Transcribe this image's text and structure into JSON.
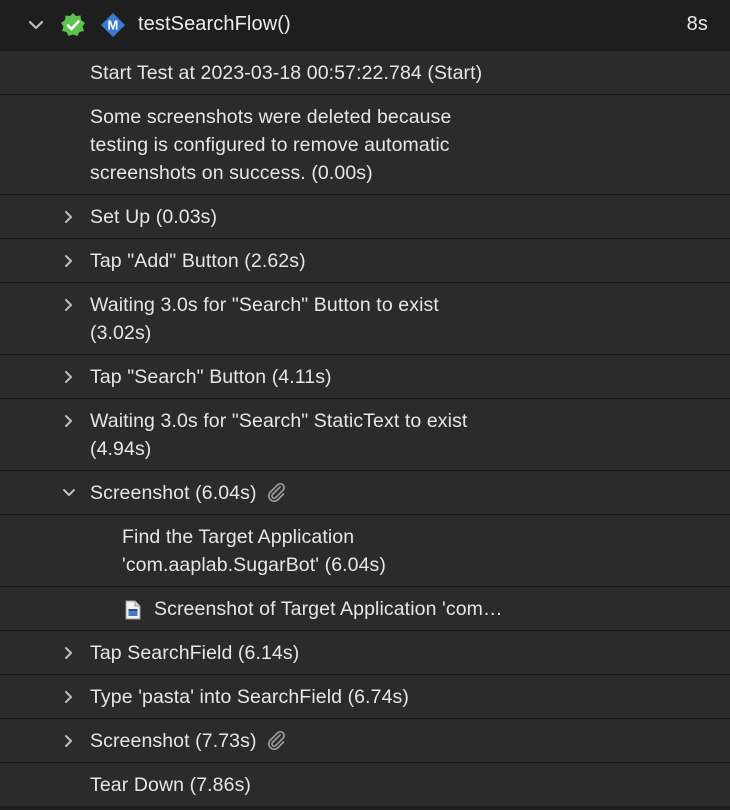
{
  "header": {
    "title": "testSearchFlow()",
    "duration": "8s",
    "badge_letter": "M",
    "pass_color": "#5ec04f",
    "badge_color": "#3a7bd5",
    "expand_icon": "chevron-down-icon",
    "status_icon": "checkmark-passed-icon"
  },
  "rows": [
    {
      "lines": [
        "Start Test at 2023-03-18 00:57:22.784 (Start)"
      ],
      "disclosure": "none"
    },
    {
      "lines": [
        "Some screenshots were deleted because",
        "testing is configured to remove automatic",
        "screenshots on success. (0.00s)"
      ],
      "disclosure": "none"
    },
    {
      "lines": [
        "Set Up (0.03s)"
      ],
      "disclosure": "collapsed"
    },
    {
      "lines": [
        "Tap \"Add\" Button (2.62s)"
      ],
      "disclosure": "collapsed"
    },
    {
      "lines": [
        "Waiting 3.0s for \"Search\" Button to exist",
        "(3.02s)"
      ],
      "disclosure": "collapsed"
    },
    {
      "lines": [
        "Tap \"Search\" Button (4.11s)"
      ],
      "disclosure": "collapsed"
    },
    {
      "lines": [
        "Waiting 3.0s for \"Search\" StaticText to exist",
        "(4.94s)"
      ],
      "disclosure": "collapsed"
    },
    {
      "lines": [
        "Screenshot (6.04s)"
      ],
      "disclosure": "expanded",
      "attachment": true
    },
    {
      "lines": [
        "Find the Target Application",
        "'com.aaplab.SugarBot' (6.04s)"
      ],
      "disclosure": "none",
      "indent": 1
    },
    {
      "lines": [
        "Screenshot of Target Application 'com…"
      ],
      "disclosure": "none",
      "indent": 1,
      "icon": "document-icon"
    },
    {
      "lines": [
        "Tap SearchField (6.14s)"
      ],
      "disclosure": "collapsed"
    },
    {
      "lines": [
        "Type 'pasta' into SearchField (6.74s)"
      ],
      "disclosure": "collapsed"
    },
    {
      "lines": [
        "Screenshot (7.73s)"
      ],
      "disclosure": "collapsed",
      "attachment": true
    },
    {
      "lines": [
        "Tear Down (7.86s)"
      ],
      "disclosure": "none"
    }
  ]
}
